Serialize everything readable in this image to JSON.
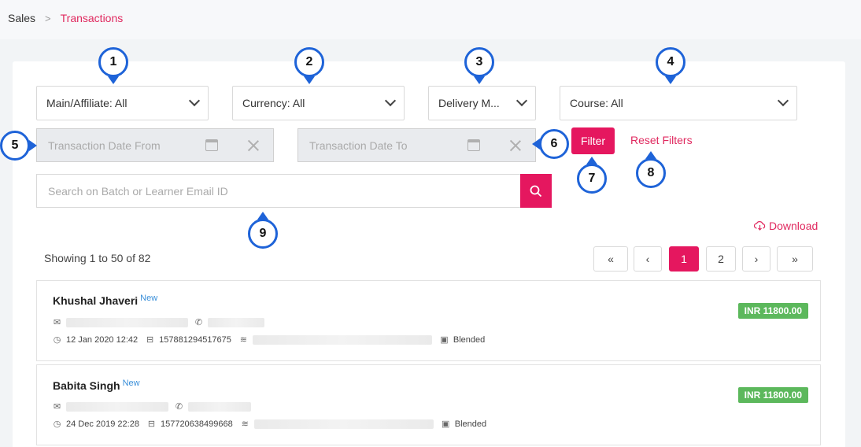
{
  "breadcrumb": {
    "root": "Sales",
    "separator": ">",
    "current": "Transactions"
  },
  "filters": {
    "main_affiliate": "Main/Affiliate: All",
    "currency": "Currency: All",
    "delivery": "Delivery M...",
    "course": "Course: All",
    "date_from_placeholder": "Transaction Date From",
    "date_to_placeholder": "Transaction Date To",
    "filter_label": "Filter",
    "reset_label": "Reset Filters"
  },
  "search": {
    "placeholder": "Search on Batch or Learner Email ID"
  },
  "download_label": "Download",
  "showing_text": "Showing 1 to 50 of 82",
  "pagination": {
    "first": "«",
    "prev": "‹",
    "pages": [
      "1",
      "2"
    ],
    "active_page": "1",
    "next": "›",
    "last": "»"
  },
  "transactions": [
    {
      "name": "Khushal Jhaveri",
      "new_tag": "New",
      "datetime": "12 Jan 2020 12:42",
      "txn_id": "157881294517675",
      "mode": "Blended",
      "amount": "INR 11800.00"
    },
    {
      "name": "Babita Singh",
      "new_tag": "New",
      "datetime": "24 Dec 2019 22:28",
      "txn_id": "157720638499668",
      "mode": "Blended",
      "amount": "INR 11800.00"
    }
  ],
  "annotations": [
    "1",
    "2",
    "3",
    "4",
    "5",
    "6",
    "7",
    "8",
    "9"
  ],
  "colors": {
    "accent": "#e5175f",
    "annotation": "#1e63d8",
    "amount_badge": "#5cb85c",
    "new_tag": "#3a8fd9"
  },
  "icons": {
    "calendar": "calendar-icon",
    "clear": "clear-icon",
    "search": "search-icon",
    "download": "cloud-download-icon",
    "mail": "mail-icon",
    "phone": "phone-icon",
    "clock": "clock-icon",
    "receipt": "receipt-icon",
    "layers": "layers-icon"
  }
}
